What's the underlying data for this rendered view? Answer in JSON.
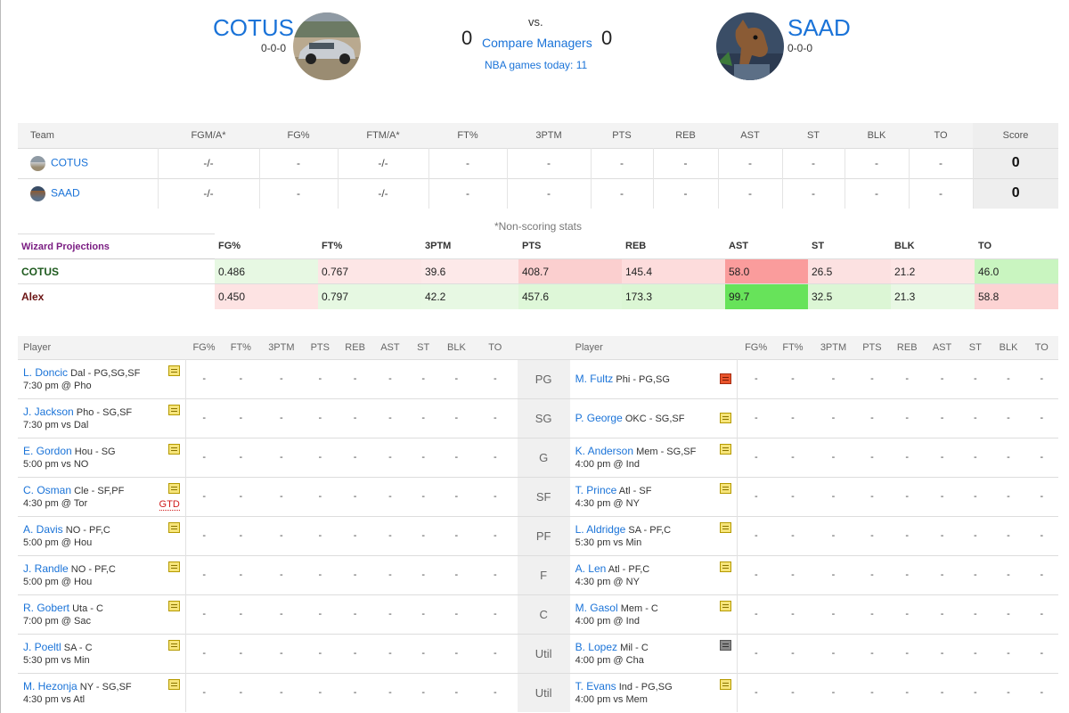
{
  "header": {
    "left": {
      "name": "COTUS",
      "record": "0-0-0",
      "score": "0"
    },
    "right": {
      "name": "SAAD",
      "record": "0-0-0",
      "score": "0"
    },
    "vs": "vs.",
    "compare": "Compare Managers",
    "games_today": "NBA games today: 11"
  },
  "scoreboard": {
    "columns": [
      "Team",
      "FGM/A*",
      "FG%",
      "FTM/A*",
      "FT%",
      "3PTM",
      "PTS",
      "REB",
      "AST",
      "ST",
      "BLK",
      "TO",
      "Score"
    ],
    "rows": [
      {
        "team": "COTUS",
        "cells": [
          "-/-",
          "-",
          "-/-",
          "-",
          "-",
          "-",
          "-",
          "-",
          "-",
          "-",
          "-"
        ],
        "score": "0"
      },
      {
        "team": "SAAD",
        "cells": [
          "-/-",
          "-",
          "-/-",
          "-",
          "-",
          "-",
          "-",
          "-",
          "-",
          "-",
          "-"
        ],
        "score": "0"
      }
    ],
    "footnote": "*Non-scoring stats"
  },
  "projections": {
    "title": "Wizard Projections",
    "columns": [
      "FG%",
      "FT%",
      "3PTM",
      "PTS",
      "REB",
      "AST",
      "ST",
      "BLK",
      "TO"
    ],
    "rows": [
      {
        "team": "COTUS",
        "team_color": "#1e5a1e",
        "values": [
          "0.486",
          "0.767",
          "39.6",
          "408.7",
          "145.4",
          "58.0",
          "26.5",
          "21.2",
          "46.0"
        ],
        "colors": [
          "#e7f8e3",
          "#fde6e6",
          "#fde9e9",
          "#fbcfcf",
          "#fddcdc",
          "#fa9c9c",
          "#fce1e1",
          "#fde6e6",
          "#c9f5c0"
        ]
      },
      {
        "team": "Alex",
        "team_color": "#6b1414",
        "values": [
          "0.450",
          "0.797",
          "42.2",
          "457.6",
          "173.3",
          "99.7",
          "32.5",
          "21.3",
          "58.8"
        ],
        "colors": [
          "#fde3e3",
          "#e6f8e2",
          "#e7f8e3",
          "#def7d8",
          "#dbf6d4",
          "#67e35a",
          "#dcf6d5",
          "#e8f8e4",
          "#fcd3d3"
        ]
      }
    ]
  },
  "roster": {
    "columns": [
      "Player",
      "FG%",
      "FT%",
      "3PTM",
      "PTS",
      "REB",
      "AST",
      "ST",
      "BLK",
      "TO"
    ],
    "rows": [
      {
        "pos": "PG",
        "left": {
          "name": "L. Doncic",
          "meta": "Dal - PG,SG,SF",
          "game": "7:30 pm @ Pho",
          "note": "yellow",
          "status": ""
        },
        "right": {
          "name": "M. Fultz",
          "meta": "Phi - PG,SG",
          "game": "",
          "note": "red",
          "status": ""
        }
      },
      {
        "pos": "SG",
        "left": {
          "name": "J. Jackson",
          "meta": "Pho - SG,SF",
          "game": "7:30 pm vs Dal",
          "note": "yellow",
          "status": ""
        },
        "right": {
          "name": "P. George",
          "meta": "OKC - SG,SF",
          "game": "",
          "note": "yellow",
          "status": ""
        }
      },
      {
        "pos": "G",
        "left": {
          "name": "E. Gordon",
          "meta": "Hou - SG",
          "game": "5:00 pm vs NO",
          "note": "yellow",
          "status": ""
        },
        "right": {
          "name": "K. Anderson",
          "meta": "Mem - SG,SF",
          "game": "4:00 pm @ Ind",
          "note": "yellow",
          "status": ""
        }
      },
      {
        "pos": "SF",
        "left": {
          "name": "C. Osman",
          "meta": "Cle - SF,PF",
          "game": "4:30 pm @ Tor",
          "note": "yellow",
          "status": "GTD"
        },
        "right": {
          "name": "T. Prince",
          "meta": "Atl - SF",
          "game": "4:30 pm @ NY",
          "note": "yellow",
          "status": ""
        }
      },
      {
        "pos": "PF",
        "left": {
          "name": "A. Davis",
          "meta": "NO - PF,C",
          "game": "5:00 pm @ Hou",
          "note": "yellow",
          "status": ""
        },
        "right": {
          "name": "L. Aldridge",
          "meta": "SA - PF,C",
          "game": "5:30 pm vs Min",
          "note": "yellow",
          "status": ""
        }
      },
      {
        "pos": "F",
        "left": {
          "name": "J. Randle",
          "meta": "NO - PF,C",
          "game": "5:00 pm @ Hou",
          "note": "yellow",
          "status": ""
        },
        "right": {
          "name": "A. Len",
          "meta": "Atl - PF,C",
          "game": "4:30 pm @ NY",
          "note": "yellow",
          "status": ""
        }
      },
      {
        "pos": "C",
        "left": {
          "name": "R. Gobert",
          "meta": "Uta - C",
          "game": "7:00 pm @ Sac",
          "note": "yellow",
          "status": ""
        },
        "right": {
          "name": "M. Gasol",
          "meta": "Mem - C",
          "game": "4:00 pm @ Ind",
          "note": "yellow",
          "status": ""
        }
      },
      {
        "pos": "Util",
        "left": {
          "name": "J. Poeltl",
          "meta": "SA - C",
          "game": "5:30 pm vs Min",
          "note": "yellow",
          "status": ""
        },
        "right": {
          "name": "B. Lopez",
          "meta": "Mil - C",
          "game": "4:00 pm @ Cha",
          "note": "gray",
          "status": ""
        }
      },
      {
        "pos": "Util",
        "left": {
          "name": "M. Hezonja",
          "meta": "NY - SG,SF",
          "game": "4:30 pm vs Atl",
          "note": "yellow",
          "status": ""
        },
        "right": {
          "name": "T. Evans",
          "meta": "Ind - PG,SG",
          "game": "4:00 pm vs Mem",
          "note": "yellow",
          "status": ""
        }
      }
    ]
  }
}
